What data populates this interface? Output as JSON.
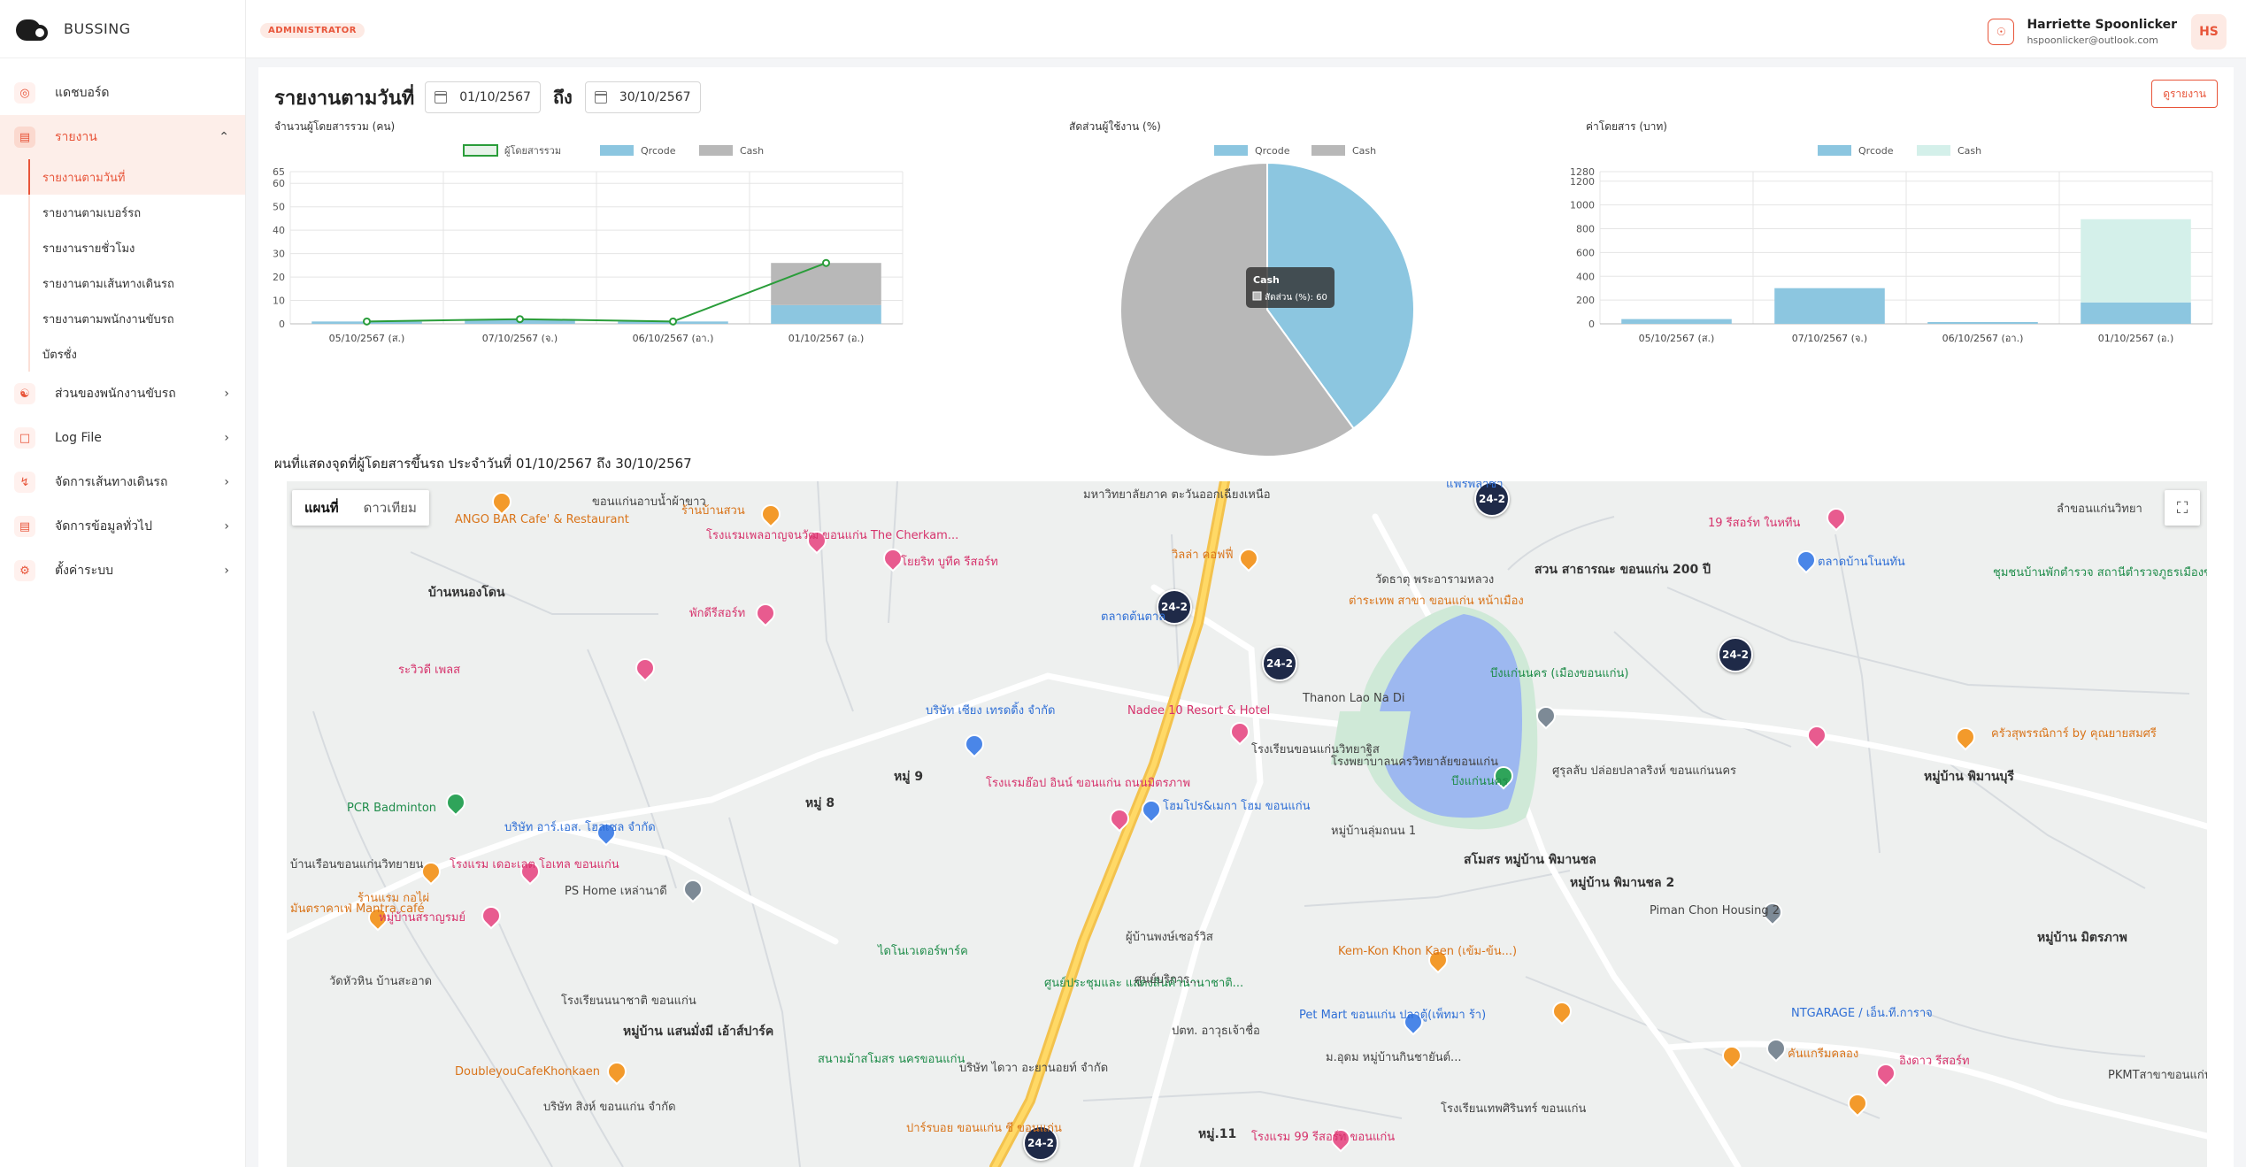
{
  "app": {
    "name": "BUSSING"
  },
  "header": {
    "role": "ADMINISTRATOR",
    "user_name": "Harriette Spoonlicker",
    "user_email": "hspoonlicker@outlook.com",
    "avatar_initials": "HS"
  },
  "sidebar": {
    "dashboard": "แดชบอร์ด",
    "reports": "รายงาน",
    "report_items": [
      "รายงานตามวันที่",
      "รายงานตามเบอร์รถ",
      "รายงานรายชั่วโมง",
      "รายงานตามเส้นทางเดินรถ",
      "รายงานตามพนักงานขับรถ",
      "บัตรชั่ง"
    ],
    "driver_section": "ส่วนของพนักงานขับรถ",
    "log_file": "Log File",
    "route_mgmt": "จัดการเส้นทางเดินรถ",
    "general_data": "จัดการข้อมูลทั่วไป",
    "settings": "ตั้งค่าระบบ"
  },
  "main": {
    "title": "รายงานตามวันที่",
    "date_from": "01/10/2567",
    "to_label": "ถึง",
    "date_to": "30/10/2567",
    "view_report": "ดูรายงาน",
    "map_title": "ผนที่แสดงจุดที่ผู้โดยสารขึ้นรถ ประจำวันที่ 01/10/2567 ถึง 30/10/2567"
  },
  "colors": {
    "accent": "#e8553a",
    "qrcode": "#8cc6e0",
    "cash": "#b8b8b8",
    "total_line": "#2a9d3a",
    "fare_cash": "#d4f0ea"
  },
  "chart_data": [
    {
      "type": "bar",
      "title": "จำนวนผู้โดยสารรวม (คน)",
      "categories": [
        "05/10/2567 (ส.)",
        "07/10/2567 (จ.)",
        "06/10/2567 (อา.)",
        "01/10/2567 (อ.)"
      ],
      "series": [
        {
          "name": "ผู้โดยสารรวม",
          "values": [
            1,
            2,
            1,
            26
          ]
        },
        {
          "name": "Qrcode",
          "values": [
            1,
            2,
            1,
            8
          ]
        },
        {
          "name": "Cash",
          "values": [
            0,
            0,
            0,
            18
          ]
        }
      ],
      "yticks": [
        0,
        10,
        20,
        30,
        40,
        50,
        60,
        65
      ],
      "ylim": [
        0,
        65
      ]
    },
    {
      "type": "pie",
      "title": "สัดส่วนผู้ใช้งาน (%)",
      "labels": [
        "Qrcode",
        "Cash"
      ],
      "values": [
        40,
        60
      ],
      "tooltip": {
        "title": "Cash",
        "text": "สัดส่วน (%): 60"
      }
    },
    {
      "type": "bar",
      "title": "ค่าโดยสาร (บาท)",
      "categories": [
        "05/10/2567 (ส.)",
        "07/10/2567 (จ.)",
        "06/10/2567 (อา.)",
        "01/10/2567 (อ.)"
      ],
      "series": [
        {
          "name": "Qrcode",
          "values": [
            40,
            300,
            15,
            180
          ]
        },
        {
          "name": "Cash",
          "values": [
            0,
            0,
            0,
            700
          ]
        }
      ],
      "yticks": [
        0,
        200,
        400,
        600,
        800,
        1000,
        1200,
        1280
      ],
      "ylim": [
        0,
        1280
      ]
    }
  ],
  "map": {
    "tab_map": "แผนที่",
    "tab_satellite": "ดาวเทียม",
    "markers": [
      "24-2",
      "24-2",
      "24-2",
      "24-2",
      "24-2"
    ],
    "places": [
      "ANGO BAR Cafe' & Restaurant",
      "ขอนแก่นอาบน้ำผ้าขาว",
      "ร้านบ้านสวน",
      "โรงแรมเพลอาญจนวัฒ ขอนแก่น The Cherkam...",
      "มหาวิทยาลัยภาค ตะวันออกเฉียงเหนือ",
      "โยยริท บูทีค รีสอร์ท",
      "บ้านหนองโดน",
      "พักดีรีสอร์ท",
      "วิลล่า คอฟฟี่",
      "ตลาดต้นตาล",
      "วัดธาตุ พระอารามหลวง",
      "ต่าระเทพ สาขา ขอนแก่น หน้าเมือง",
      "สวน สาธารณะ ขอนแก่น 200 ปี",
      "แฟร์พลาซ่า",
      "19 รีสอร์ท ในหทีน",
      "ตลาดบ้านโนนทัน",
      "ระวิวดี เพลส",
      "บริษัท เซียง เทรดดิ้ง จำกัด",
      "Nadee 10 Resort & Hotel",
      "Thanon Lao Na Di",
      "บึงแก่นนคร (เมืองขอนแก่น)",
      "ศูรุลลับ ปล่อยปลาลริงห์ ขอนแก่นนคร",
      "PCR Badminton",
      "โรงแรมฮ๊อป อินน์ ขอนแก่น ถนนมิตรภาพ",
      "โฮมโปร&เมกา โฮม ขอนแก่น",
      "บริษัท อาร์.เอส. โฮลเซล จำกัด",
      "โรงแรม เดอะเลต โอเทล ขอนแก่น",
      "PS Home เหล่านาดี",
      "สโมสร หมู่บ้าน พิมานชล",
      "หมู่บ้าน พิมานชล 2",
      "Piman Chon Housing 2",
      "Kem-Kon Khon Kaen (เข้ม-ข้น...)",
      "ร้านแรม กอไผ่",
      "มันตราคาเฟ่ Mantra café",
      "หมู่บ้านสราญรมย์",
      "DoubleyouCafeKhonkaen",
      "Pet Mart ขอนแก่น ปลาตู้(เพ็ทมา ร้า)",
      "NTGARAGE / เอ็น.ที.การาจ",
      "คันแกรีมคลอง",
      "อิงดาว รีสอร์ท",
      "PKMTสาขาขอนแก่น (เติมน้ำมัน)",
      "ครัวสุพรรณิการ์ by คุณยายสมศรี",
      "หมู่บ้าน พิมานบุรี",
      "หมู่บ้าน มิตรภาพ",
      "ชุมชนบ้านพักตำรวจ สถานีตำรวจภูธรเมืองขอนแก่น",
      "ไดโนเวเตอร์พาร์ค",
      "ศูนย์ประชุมและ แสดงสินค้านานาชาติ...",
      "สนามม้าสโมสร นครขอนแก่น",
      "บริษัท ไดวา อะยานอยท์ จำกัด",
      "หมู่บ้าน แสนมั่งมี เอ้าส์ปาร์ค",
      "บริษัท สิงห์ ขอนแก่น จำกัด",
      "ปาร์รบอย ขอนแก่น ชี ขอนแก่น",
      "โรงแรม 99 รีสอร์ท ขอนแก่น",
      "โรงเรียนขอนแก่นวิทยาฐิส",
      "หมู่ 9",
      "หมู่ 8",
      "หมู่.11",
      "วัดหัวหิน บ้านสะอาด",
      "บ้านเรือนขอนแก่นวิทยายน",
      "โรงเรียนนนาชาติ ขอนแก่น",
      "บึงแก่นนคร",
      "ม.อุดม หมู่บ้านกินชายันต์...",
      "โรงเรียนเทพศิรินทร์ ขอนแก่น",
      "ผู้บ้านพงษ์เซอร์วิส",
      "หมู่บ้านลุ่มถนน 1",
      "ศูนย์บริการ...",
      "ปตท. อาวุธเจ้าชื่อ",
      "โรงพยาบาลนครวิทยาลัยขอนแก่น",
      "ลำขอนแก่นวิทยา"
    ]
  }
}
